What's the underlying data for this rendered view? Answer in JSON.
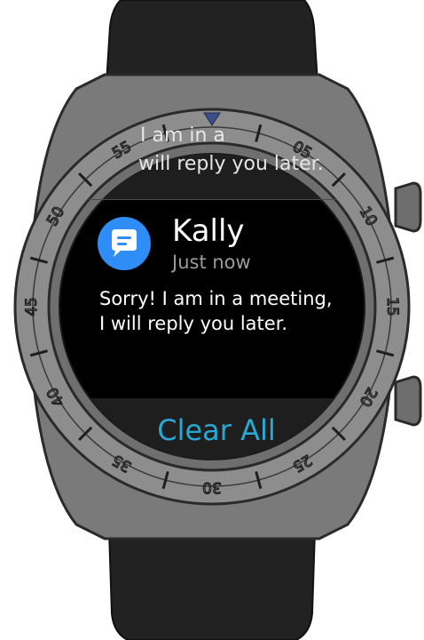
{
  "device": {
    "bezel_numbers": [
      "05",
      "10",
      "15",
      "20",
      "25",
      "30",
      "35",
      "40",
      "45",
      "50",
      "55"
    ]
  },
  "colors": {
    "accent": "#29a8d6",
    "icon_bg": "#2f8df7",
    "bezel_marker": "#3b4f8a",
    "screen_bg": "#000000",
    "strap": "#202020",
    "case": "#7a7a7a"
  },
  "notifications": {
    "previous": {
      "line1": "I am in a",
      "line2": "will reply you later."
    },
    "current": {
      "icon": "chat-bubble-icon",
      "sender": "Kally",
      "time": "Just now",
      "body_lines": [
        "Sorry! I am in a meeting,",
        "I will reply you later."
      ]
    },
    "clear_all_label": "Clear All"
  }
}
